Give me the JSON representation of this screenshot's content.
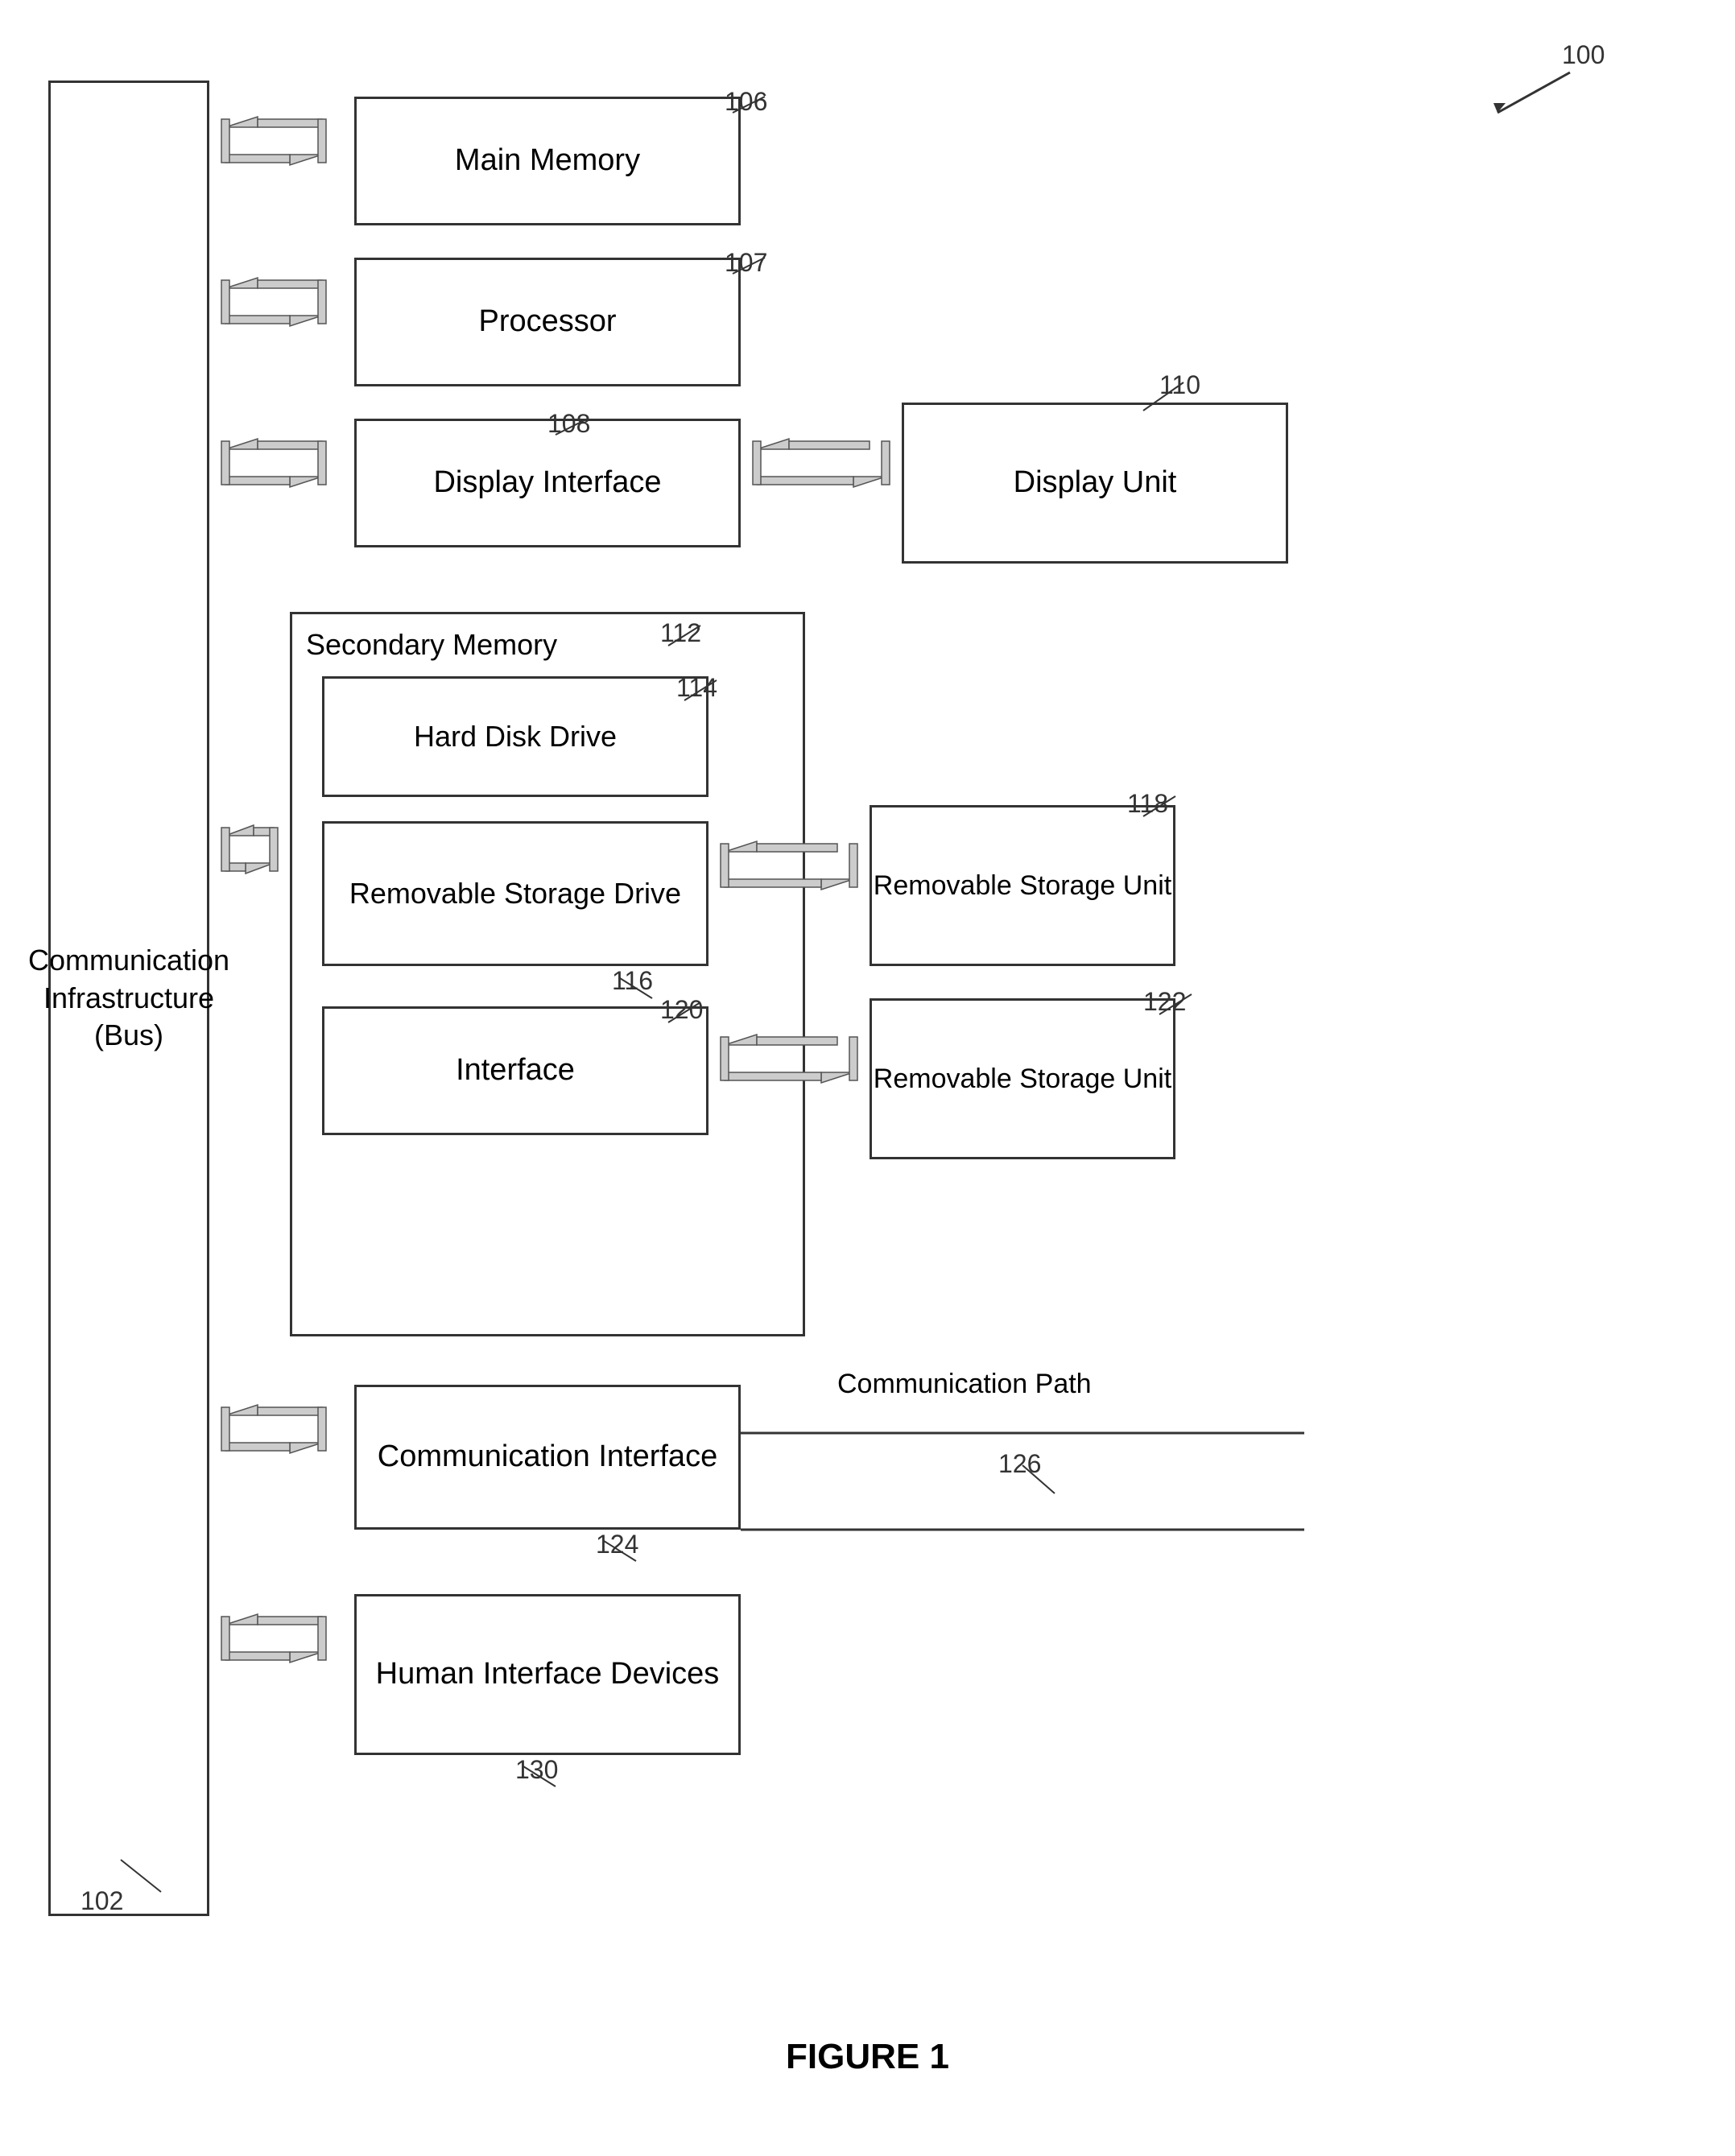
{
  "diagram": {
    "title": "FIGURE 1",
    "ref100": "100",
    "ref102": "102",
    "commInfra": {
      "label": "Communication Infrastructure\n(Bus)",
      "ref": "102"
    },
    "mainMemory": {
      "label": "Main Memory",
      "ref": "106"
    },
    "processor": {
      "label": "Processor",
      "ref": "107"
    },
    "displayInterface": {
      "label": "Display Interface",
      "ref": "108"
    },
    "displayUnit": {
      "label": "Display Unit",
      "ref": "110"
    },
    "secondaryMemory": {
      "label": "Secondary Memory",
      "ref": "112"
    },
    "hardDiskDrive": {
      "label": "Hard Disk Drive",
      "ref": "114"
    },
    "removableStorageDrive": {
      "label": "Removable Storage Drive",
      "ref": "116"
    },
    "removableStorageUnit1": {
      "label": "Removable Storage Unit",
      "ref": "118"
    },
    "interface": {
      "label": "Interface",
      "ref": "120"
    },
    "removableStorageUnit2": {
      "label": "Removable Storage Unit",
      "ref": "122"
    },
    "commInterface": {
      "label": "Communication Interface",
      "ref": "124"
    },
    "commPath": {
      "label": "Communication Path",
      "ref": "126"
    },
    "humanInterface": {
      "label": "Human Interface Devices",
      "ref": "130"
    }
  }
}
